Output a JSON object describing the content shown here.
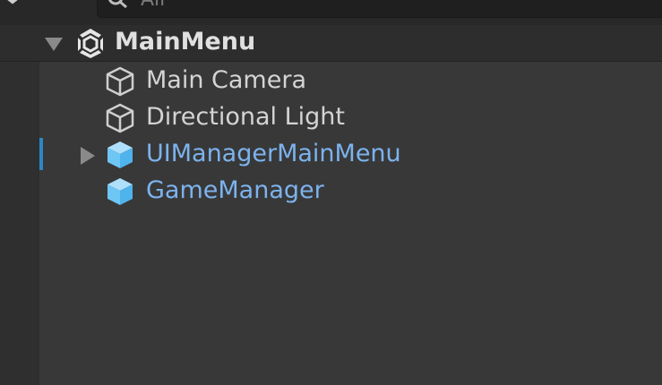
{
  "search": {
    "placeholder": "All"
  },
  "scene": {
    "name": "MainMenu"
  },
  "hierarchy": [
    {
      "label": "Main Camera",
      "color": "#d4d4d4",
      "icon": "cube-outline-icon",
      "expandable": false
    },
    {
      "label": "Directional Light",
      "color": "#d4d4d4",
      "icon": "cube-outline-icon",
      "expandable": false
    },
    {
      "label": "UIManagerMainMenu",
      "color": "#7cb3ee",
      "icon": "prefab-cube-icon",
      "expandable": true
    },
    {
      "label": "GameManager",
      "color": "#7cb3ee",
      "icon": "prefab-cube-icon",
      "expandable": false
    }
  ],
  "colors": {
    "text_default": "#d4d4d4",
    "prefab_text": "#7cb3ee",
    "prefab_icon": "#6ec6f5",
    "selection_marker": "#2d86c7"
  }
}
